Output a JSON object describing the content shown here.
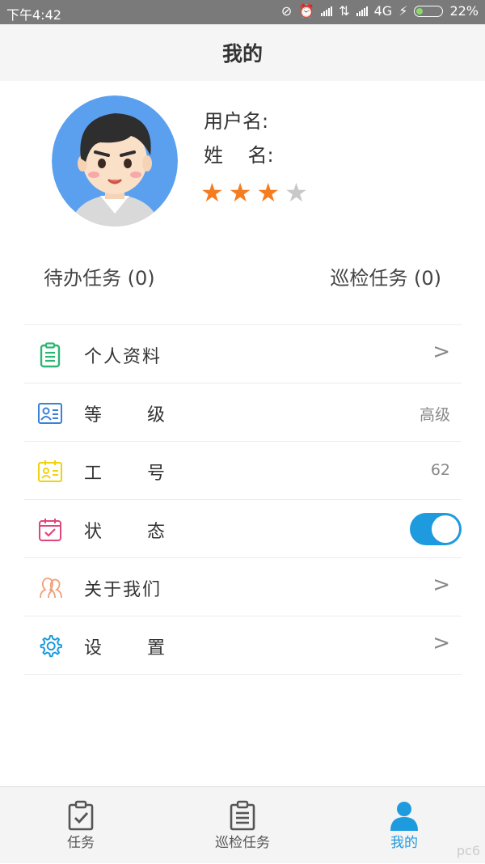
{
  "status_bar": {
    "time": "下午4:42",
    "network": "4G",
    "battery": "22%"
  },
  "header": {
    "title": "我的"
  },
  "profile": {
    "username_label": "用户名:",
    "name_label": "姓    名:",
    "rating": 3,
    "rating_max": 5,
    "star_color": "#f57c1f",
    "star_empty_color": "#c8c8c8"
  },
  "counts": {
    "todo": "待办任务 (0)",
    "patrol": "巡检任务 (0)"
  },
  "menu": [
    {
      "label": "个人资料",
      "icon": "clipboard-icon",
      "trailing": "chevron",
      "trailing_text": ">"
    },
    {
      "label": "等      级",
      "icon": "id-card-icon",
      "trailing": "value",
      "trailing_text": "高级"
    },
    {
      "label": "工      号",
      "icon": "badge-icon",
      "trailing": "value",
      "trailing_text": "62"
    },
    {
      "label": "状      态",
      "icon": "calendar-check-icon",
      "trailing": "toggle",
      "toggle_on": true
    },
    {
      "label": "关于我们",
      "icon": "users-icon",
      "trailing": "chevron",
      "trailing_text": ">"
    },
    {
      "label": "设      置",
      "icon": "gear-icon",
      "trailing": "chevron",
      "trailing_text": ">"
    }
  ],
  "tabs": [
    {
      "label": "任务",
      "icon": "clipboard-check-icon",
      "active": false
    },
    {
      "label": "巡检任务",
      "icon": "list-clipboard-icon",
      "active": false
    },
    {
      "label": "我的",
      "icon": "person-icon",
      "active": true
    }
  ],
  "colors": {
    "accent": "#1e9bde",
    "status_bar": "#7a7a7a"
  },
  "watermark": "pc6"
}
